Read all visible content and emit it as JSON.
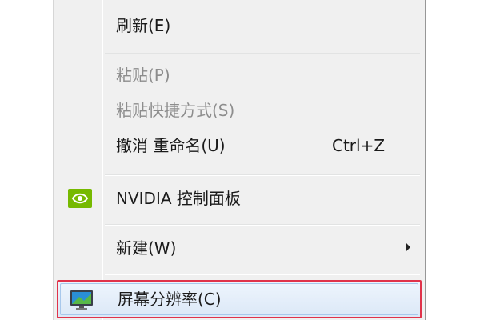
{
  "menu": {
    "items": [
      {
        "label": "刷新(E)",
        "enabled": true
      },
      {
        "label": "粘贴(P)",
        "enabled": false
      },
      {
        "label": "粘贴快捷方式(S)",
        "enabled": false
      },
      {
        "label": "撤消 重命名(U)",
        "shortcut": "Ctrl+Z",
        "enabled": true
      },
      {
        "label": "NVIDIA 控制面板",
        "icon": "nvidia-logo-icon",
        "enabled": true
      },
      {
        "label": "新建(W)",
        "submenu": true,
        "enabled": true
      },
      {
        "label": "屏幕分辨率(C)",
        "icon": "monitor-icon",
        "enabled": true,
        "highlighted": true
      }
    ]
  },
  "colors": {
    "menu_bg": "#f0f0f0",
    "disabled_text": "#8d8d8d",
    "highlight_border": "#e0334a",
    "nvidia_green": "#76b900"
  }
}
